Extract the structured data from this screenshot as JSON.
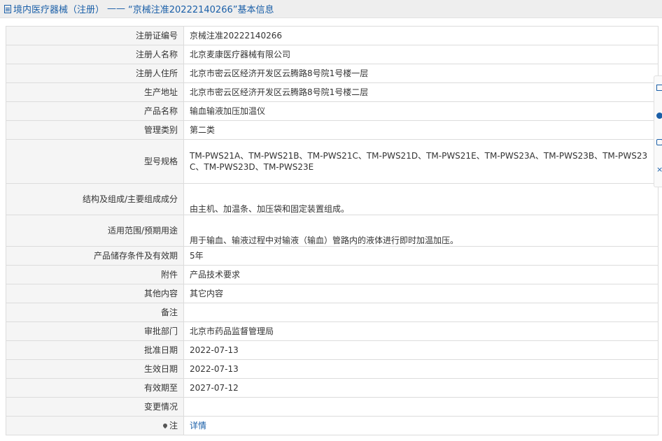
{
  "title": {
    "category": "境内医疗器械（注册）",
    "separator": "——",
    "heading": "“京械注准20222140266”基本信息"
  },
  "rows": [
    {
      "label": "注册证编号",
      "value": "京械注准20222140266"
    },
    {
      "label": "注册人名称",
      "value": "北京麦康医疗器械有限公司"
    },
    {
      "label": "注册人住所",
      "value": "北京市密云区经济开发区云腾路8号院1号楼一层"
    },
    {
      "label": "生产地址",
      "value": "北京市密云区经济开发区云腾路8号院1号楼二层"
    },
    {
      "label": "产品名称",
      "value": "输血输液加压加温仪"
    },
    {
      "label": "管理类别",
      "value": "第二类"
    },
    {
      "label": "型号规格",
      "value": "TM-PWS21A、TM-PWS21B、TM-PWS21C、TM-PWS21D、TM-PWS21E、TM-PWS23A、TM-PWS23B、TM-PWS23C、TM-PWS23D、TM-PWS23E"
    },
    {
      "label": "结构及组成/主要组成成分",
      "value": "由主机、加温条、加压袋和固定装置组成。"
    },
    {
      "label": "适用范围/预期用途",
      "value": "用于输血、输液过程中对输液（输血）管路内的液体进行即时加温加压。"
    },
    {
      "label": "产品储存条件及有效期",
      "value": "5年"
    },
    {
      "label": "附件",
      "value": "产品技术要求"
    },
    {
      "label": "其他内容",
      "value": "其它内容"
    },
    {
      "label": "备注",
      "value": ""
    },
    {
      "label": "审批部门",
      "value": "北京市药品监督管理局"
    },
    {
      "label": "批准日期",
      "value": "2022-07-13"
    },
    {
      "label": "生效日期",
      "value": "2022-07-13"
    },
    {
      "label": "有效期至",
      "value": "2027-07-12"
    },
    {
      "label": "变更情况",
      "value": ""
    },
    {
      "label": "注",
      "value": "详情"
    }
  ],
  "side_toolbar": {
    "icons": [
      "edit-icon",
      "info-icon",
      "device-icon",
      "close-icon"
    ],
    "close_glyph": "×"
  },
  "colors": {
    "link": "#1a5fa8",
    "label_bg": "#f5f5f5",
    "border": "#dcdcdc",
    "titlebar_bg": "#eeeeee"
  }
}
